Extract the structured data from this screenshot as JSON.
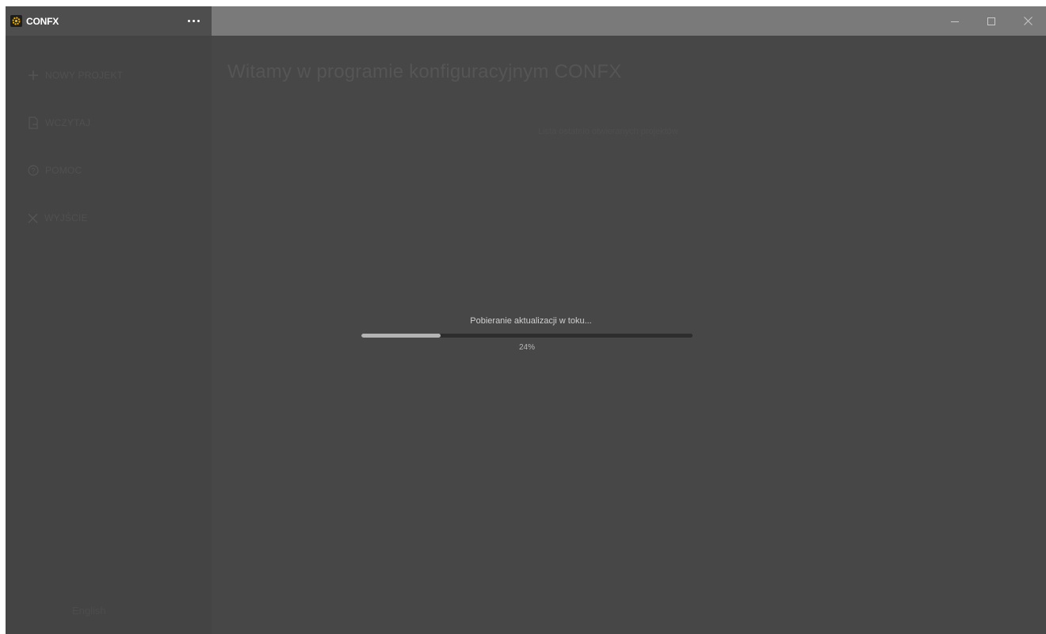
{
  "app": {
    "title": "CONFX",
    "more_label": "...",
    "accent_color": "#f0b400"
  },
  "window_controls": {
    "minimize": "minimize-icon",
    "maximize": "maximize-icon",
    "close": "close-icon"
  },
  "sidebar": {
    "items": [
      {
        "label": "NOWY PROJEKT",
        "icon": "plus-icon"
      },
      {
        "label": "WCZYTAJ",
        "icon": "file-icon"
      },
      {
        "label": "POMOC",
        "icon": "help-icon"
      },
      {
        "label": "WYJŚCIE",
        "icon": "close-icon"
      }
    ],
    "language": "English"
  },
  "main": {
    "welcome_title": "Witamy w programie konfiguracyjnym CONFX",
    "faint_link": "Lista ostatnio otwieranych projektów"
  },
  "progress": {
    "label": "Pobieranie aktualizacji w toku...",
    "percent_text": "24%",
    "value": 0.24
  }
}
